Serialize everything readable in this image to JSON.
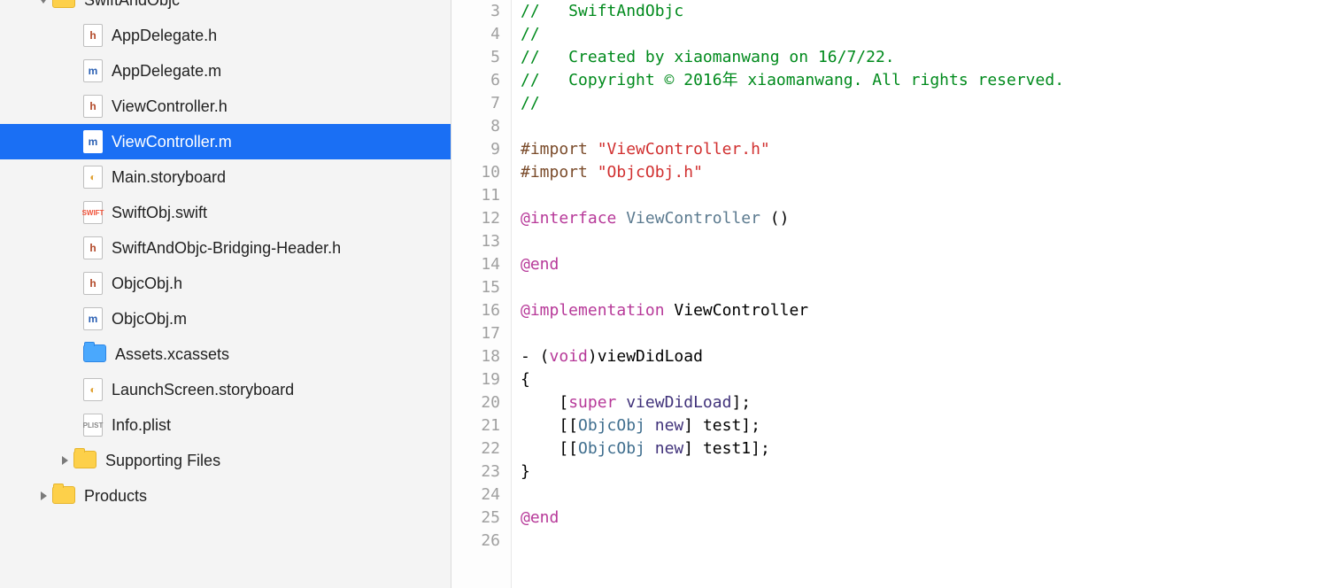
{
  "navigator": {
    "root": {
      "name": "SwiftAndObjc",
      "expanded": true
    },
    "files": [
      {
        "name": "AppDelegate.h",
        "icon": "h"
      },
      {
        "name": "AppDelegate.m",
        "icon": "m"
      },
      {
        "name": "ViewController.h",
        "icon": "h"
      },
      {
        "name": "ViewController.m",
        "icon": "m",
        "selected": true
      },
      {
        "name": "Main.storyboard",
        "icon": "sb"
      },
      {
        "name": "SwiftObj.swift",
        "icon": "swift"
      },
      {
        "name": "SwiftAndObjc-Bridging-Header.h",
        "icon": "h"
      },
      {
        "name": "ObjcObj.h",
        "icon": "h"
      },
      {
        "name": "ObjcObj.m",
        "icon": "m"
      },
      {
        "name": "Assets.xcassets",
        "icon": "assets"
      },
      {
        "name": "LaunchScreen.storyboard",
        "icon": "sb"
      },
      {
        "name": "Info.plist",
        "icon": "plist"
      }
    ],
    "groups": [
      {
        "name": "Supporting Files",
        "expanded": false
      },
      {
        "name": "Products",
        "expanded": false
      }
    ]
  },
  "editor": {
    "first_line_number": 3,
    "lines": [
      {
        "n": 3,
        "tokens": [
          {
            "t": "//   SwiftAndObjc",
            "c": "c-comment"
          }
        ]
      },
      {
        "n": 4,
        "tokens": [
          {
            "t": "//",
            "c": "c-comment"
          }
        ]
      },
      {
        "n": 5,
        "tokens": [
          {
            "t": "//   Created by xiaomanwang on 16/7/22.",
            "c": "c-comment"
          }
        ]
      },
      {
        "n": 6,
        "tokens": [
          {
            "t": "//   Copyright © 2016年 xiaomanwang. All rights reserved.",
            "c": "c-comment"
          }
        ]
      },
      {
        "n": 7,
        "tokens": [
          {
            "t": "//",
            "c": "c-comment"
          }
        ]
      },
      {
        "n": 8,
        "tokens": [
          {
            "t": "",
            "c": ""
          }
        ]
      },
      {
        "n": 9,
        "tokens": [
          {
            "t": "#import ",
            "c": "c-preproc"
          },
          {
            "t": "\"ViewController.h\"",
            "c": "c-string"
          }
        ]
      },
      {
        "n": 10,
        "tokens": [
          {
            "t": "#import ",
            "c": "c-preproc"
          },
          {
            "t": "\"ObjcObj.h\"",
            "c": "c-string"
          }
        ]
      },
      {
        "n": 11,
        "tokens": [
          {
            "t": "",
            "c": ""
          }
        ]
      },
      {
        "n": 12,
        "tokens": [
          {
            "t": "@interface",
            "c": "c-keyword"
          },
          {
            "t": " ",
            "c": ""
          },
          {
            "t": "ViewController",
            "c": "c-class"
          },
          {
            "t": " ()",
            "c": ""
          }
        ]
      },
      {
        "n": 13,
        "tokens": [
          {
            "t": "",
            "c": ""
          }
        ]
      },
      {
        "n": 14,
        "tokens": [
          {
            "t": "@end",
            "c": "c-keyword"
          }
        ]
      },
      {
        "n": 15,
        "tokens": [
          {
            "t": "",
            "c": ""
          }
        ]
      },
      {
        "n": 16,
        "tokens": [
          {
            "t": "@implementation",
            "c": "c-keyword"
          },
          {
            "t": " ViewController",
            "c": ""
          }
        ]
      },
      {
        "n": 17,
        "tokens": [
          {
            "t": "",
            "c": ""
          }
        ]
      },
      {
        "n": 18,
        "tokens": [
          {
            "t": "- (",
            "c": ""
          },
          {
            "t": "void",
            "c": "c-keyword"
          },
          {
            "t": ")viewDidLoad",
            "c": ""
          }
        ]
      },
      {
        "n": 19,
        "tokens": [
          {
            "t": "{",
            "c": ""
          }
        ]
      },
      {
        "n": 20,
        "tokens": [
          {
            "t": "    [",
            "c": ""
          },
          {
            "t": "super",
            "c": "c-super"
          },
          {
            "t": " ",
            "c": ""
          },
          {
            "t": "viewDidLoad",
            "c": "c-method"
          },
          {
            "t": "];",
            "c": ""
          }
        ]
      },
      {
        "n": 21,
        "tokens": [
          {
            "t": "    [[",
            "c": ""
          },
          {
            "t": "ObjcObj",
            "c": "c-class2"
          },
          {
            "t": " ",
            "c": ""
          },
          {
            "t": "new",
            "c": "c-method"
          },
          {
            "t": "] ",
            "c": ""
          },
          {
            "t": "test",
            "c": ""
          },
          {
            "t": "];",
            "c": ""
          }
        ]
      },
      {
        "n": 22,
        "tokens": [
          {
            "t": "    [[",
            "c": ""
          },
          {
            "t": "ObjcObj",
            "c": "c-class2"
          },
          {
            "t": " ",
            "c": ""
          },
          {
            "t": "new",
            "c": "c-method"
          },
          {
            "t": "] ",
            "c": ""
          },
          {
            "t": "test1",
            "c": ""
          },
          {
            "t": "];",
            "c": ""
          }
        ]
      },
      {
        "n": 23,
        "tokens": [
          {
            "t": "}",
            "c": ""
          }
        ]
      },
      {
        "n": 24,
        "tokens": [
          {
            "t": "",
            "c": ""
          }
        ]
      },
      {
        "n": 25,
        "tokens": [
          {
            "t": "@end",
            "c": "c-keyword"
          }
        ]
      },
      {
        "n": 26,
        "tokens": [
          {
            "t": "",
            "c": ""
          }
        ]
      }
    ]
  },
  "icon_letters": {
    "h": "h",
    "m": "m",
    "swift": "SWIFT",
    "plist": "PLIST",
    "sb": "◐"
  }
}
